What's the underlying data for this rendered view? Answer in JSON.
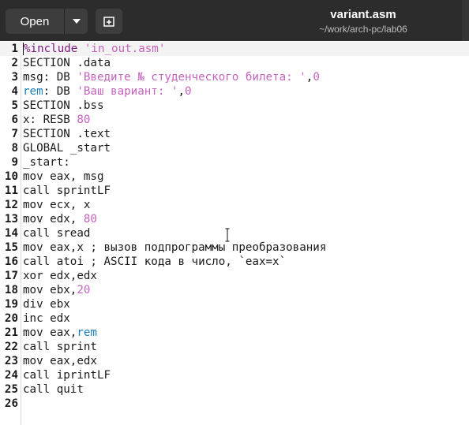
{
  "header": {
    "open_label": "Open",
    "title": "variant.asm",
    "subtitle": "~/work/arch-pc/lab06",
    "icons": [
      "chevron-down-icon",
      "new-tab-icon"
    ]
  },
  "editor": {
    "current_line": 1,
    "lines": [
      {
        "n": "1",
        "segs": [
          {
            "t": "%include ",
            "c": "pre"
          },
          {
            "t": "'in_out.asm'",
            "c": "str"
          }
        ]
      },
      {
        "n": "2",
        "segs": [
          {
            "t": "SECTION .data",
            "c": ""
          }
        ]
      },
      {
        "n": "3",
        "segs": [
          {
            "t": "msg: DB ",
            "c": ""
          },
          {
            "t": "'Введите № студенческого билета: '",
            "c": "str"
          },
          {
            "t": ",",
            "c": ""
          },
          {
            "t": "0",
            "c": "num"
          }
        ]
      },
      {
        "n": "4",
        "segs": [
          {
            "t": "rem",
            "c": "id"
          },
          {
            "t": ": DB ",
            "c": ""
          },
          {
            "t": "'Ваш вариант: '",
            "c": "str"
          },
          {
            "t": ",",
            "c": ""
          },
          {
            "t": "0",
            "c": "num"
          }
        ]
      },
      {
        "n": "5",
        "segs": [
          {
            "t": "SECTION .bss",
            "c": ""
          }
        ]
      },
      {
        "n": "6",
        "segs": [
          {
            "t": "x: RESB ",
            "c": ""
          },
          {
            "t": "80",
            "c": "num"
          }
        ]
      },
      {
        "n": "7",
        "segs": [
          {
            "t": "SECTION .text",
            "c": ""
          }
        ]
      },
      {
        "n": "8",
        "segs": [
          {
            "t": "GLOBAL _start",
            "c": ""
          }
        ]
      },
      {
        "n": "9",
        "segs": [
          {
            "t": "_start:",
            "c": ""
          }
        ]
      },
      {
        "n": "10",
        "segs": [
          {
            "t": "mov eax, msg",
            "c": ""
          }
        ]
      },
      {
        "n": "11",
        "segs": [
          {
            "t": "call sprintLF",
            "c": ""
          }
        ]
      },
      {
        "n": "12",
        "segs": [
          {
            "t": "mov ecx, x",
            "c": ""
          }
        ]
      },
      {
        "n": "13",
        "segs": [
          {
            "t": "mov edx, ",
            "c": ""
          },
          {
            "t": "80",
            "c": "num"
          }
        ]
      },
      {
        "n": "14",
        "segs": [
          {
            "t": "call sread",
            "c": ""
          }
        ]
      },
      {
        "n": "15",
        "segs": [
          {
            "t": "mov eax,x ; вызов подпрограммы преобразования",
            "c": ""
          }
        ]
      },
      {
        "n": "16",
        "segs": [
          {
            "t": "call atoi ; ASCII кода в число, `eax=x`",
            "c": ""
          }
        ]
      },
      {
        "n": "17",
        "segs": [
          {
            "t": "xor edx,edx",
            "c": ""
          }
        ]
      },
      {
        "n": "18",
        "segs": [
          {
            "t": "mov ebx,",
            "c": ""
          },
          {
            "t": "20",
            "c": "num"
          }
        ]
      },
      {
        "n": "19",
        "segs": [
          {
            "t": "div ebx",
            "c": ""
          }
        ]
      },
      {
        "n": "20",
        "segs": [
          {
            "t": "inc edx",
            "c": ""
          }
        ]
      },
      {
        "n": "21",
        "segs": [
          {
            "t": "mov eax,",
            "c": ""
          },
          {
            "t": "rem",
            "c": "id"
          }
        ]
      },
      {
        "n": "22",
        "segs": [
          {
            "t": "call sprint",
            "c": ""
          }
        ]
      },
      {
        "n": "23",
        "segs": [
          {
            "t": "mov eax,edx",
            "c": ""
          }
        ]
      },
      {
        "n": "24",
        "segs": [
          {
            "t": "call iprintLF",
            "c": ""
          }
        ]
      },
      {
        "n": "25",
        "segs": [
          {
            "t": "call quit",
            "c": ""
          }
        ]
      },
      {
        "n": "26",
        "segs": []
      }
    ]
  }
}
